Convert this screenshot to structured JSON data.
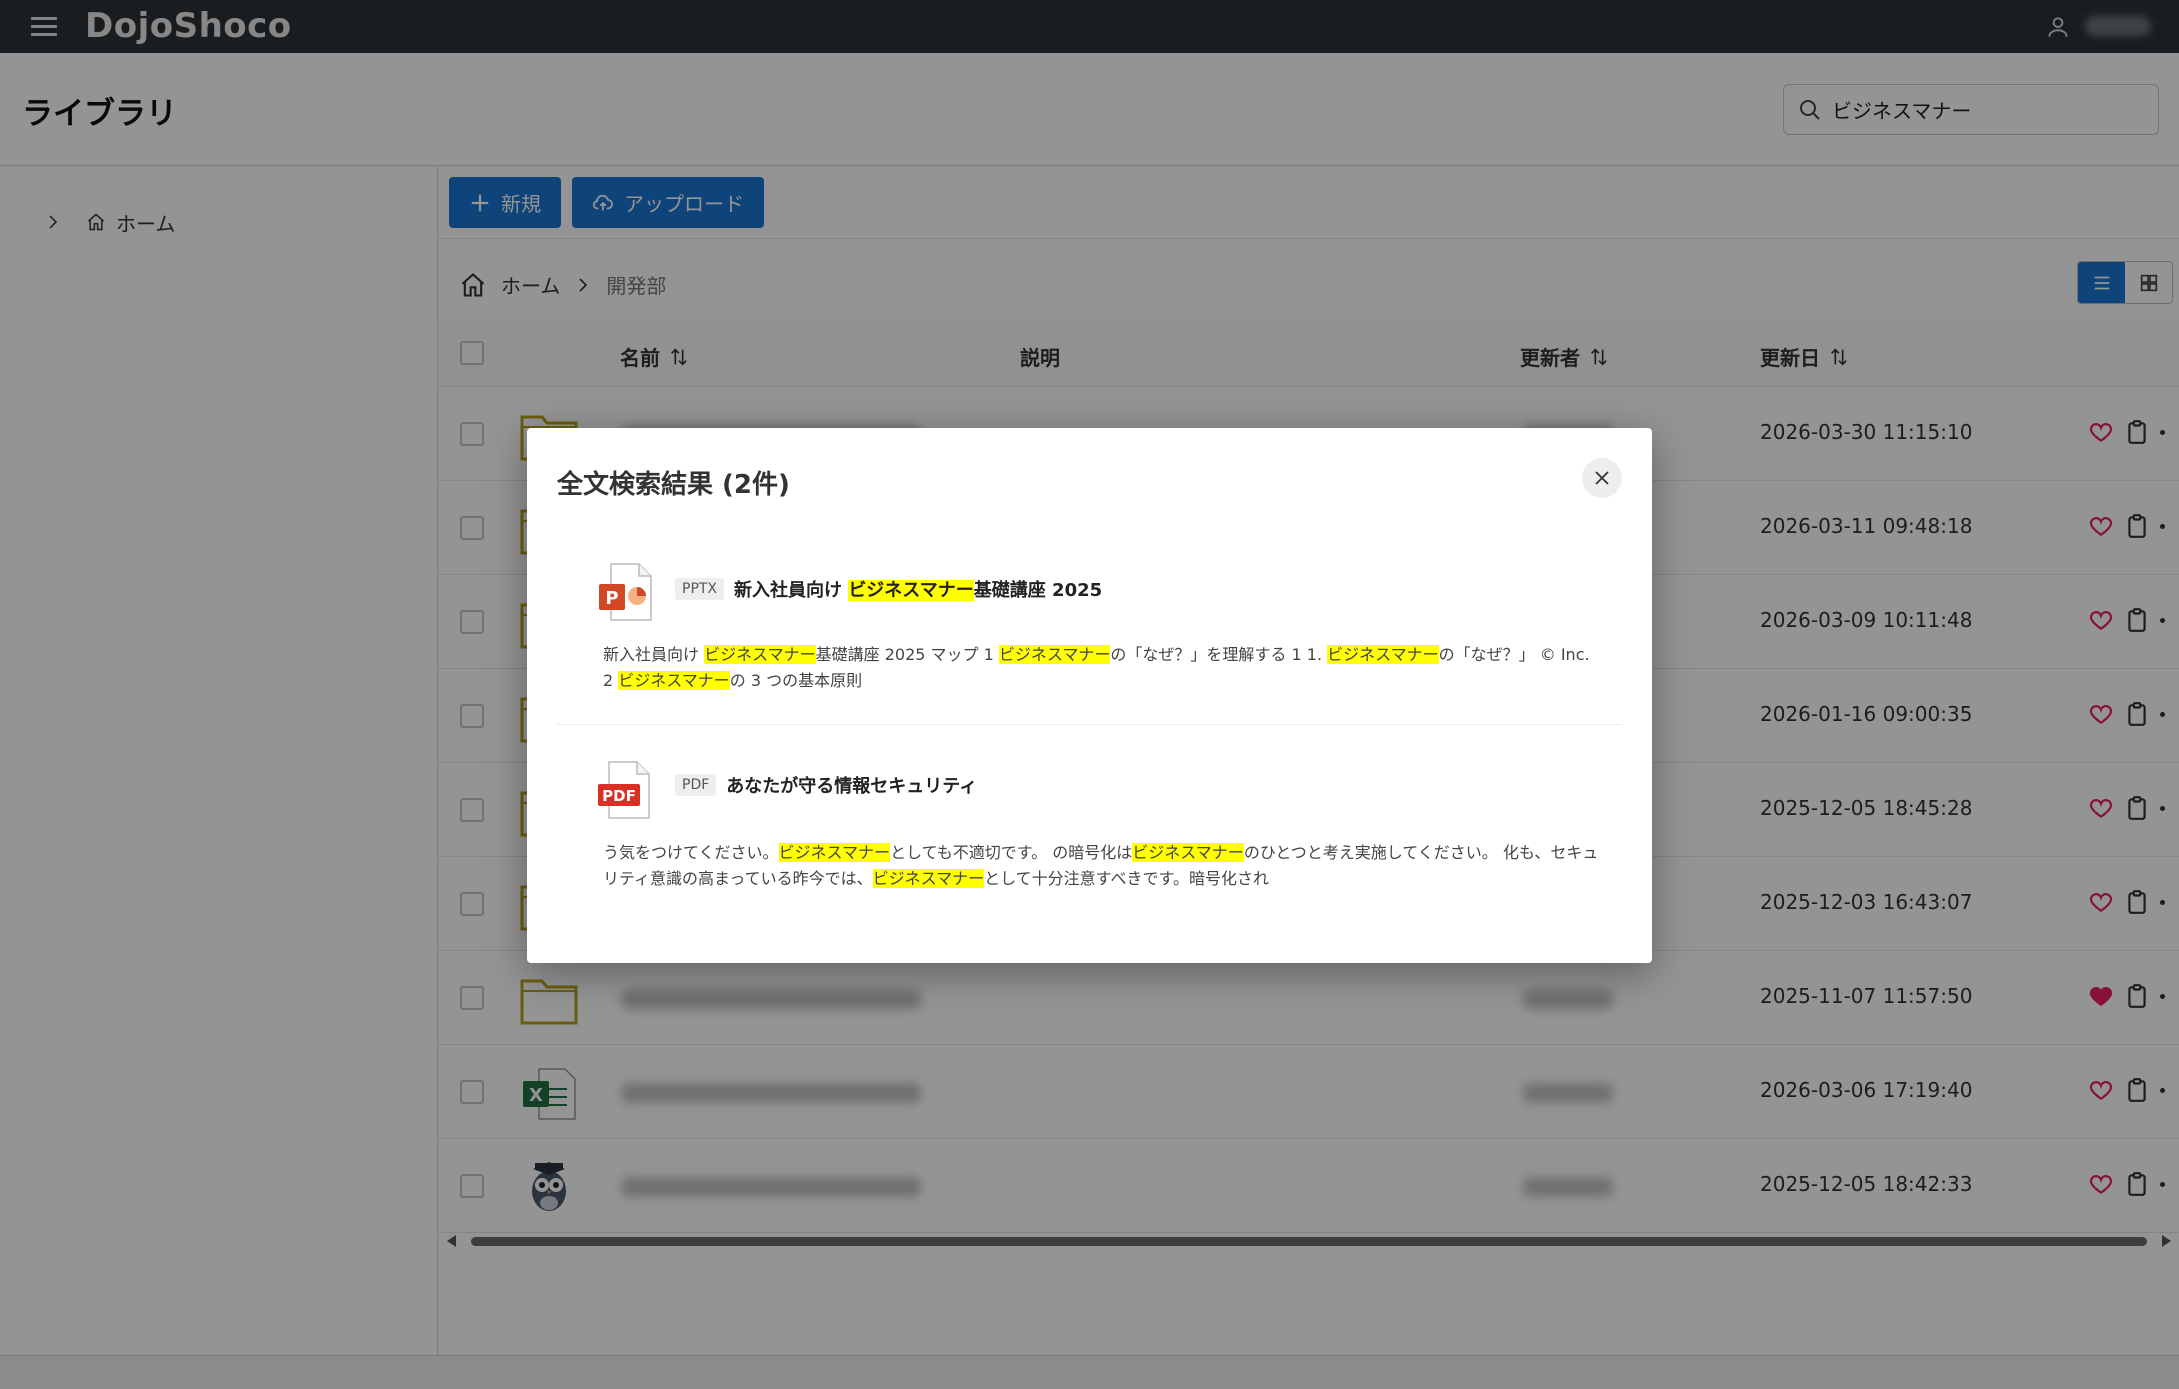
{
  "app": {
    "title": "DojoShoco"
  },
  "page": {
    "title": "ライブラリ"
  },
  "search": {
    "value": "ビジネスマナー"
  },
  "sidebar": {
    "home_label": "ホーム"
  },
  "toolbar": {
    "new_label": "新規",
    "upload_label": "アップロード"
  },
  "breadcrumb": {
    "home": "ホーム",
    "current": "開発部"
  },
  "table": {
    "headers": {
      "name": "名前",
      "description": "説明",
      "updated_by": "更新者",
      "updated_at": "更新日"
    },
    "rows": [
      {
        "type": "folder",
        "date": "2026-03-30 11:15:10",
        "favorite": false
      },
      {
        "type": "folder",
        "date": "2026-03-11 09:48:18",
        "favorite": false
      },
      {
        "type": "folder",
        "date": "2026-03-09 10:11:48",
        "favorite": false
      },
      {
        "type": "folder",
        "date": "2026-01-16 09:00:35",
        "favorite": false
      },
      {
        "type": "folder",
        "date": "2025-12-05 18:45:28",
        "favorite": false
      },
      {
        "type": "folder",
        "date": "2025-12-03 16:43:07",
        "favorite": false
      },
      {
        "type": "folder",
        "date": "2025-11-07 11:57:50",
        "favorite": true
      },
      {
        "type": "excel",
        "date": "2026-03-06 17:19:40",
        "favorite": false
      },
      {
        "type": "owl",
        "date": "2025-12-05 18:42:33",
        "favorite": false
      }
    ]
  },
  "dialog": {
    "title": "全文検索結果 (2件)",
    "results": [
      {
        "badge": "PPTX",
        "icon": "powerpoint-icon",
        "title_before": "新入社員向け ",
        "title_highlight": "ビジネスマナー",
        "title_after": "基礎講座 2025",
        "snippet": [
          {
            "t": "新入社員向け ",
            "h": false
          },
          {
            "t": "ビジネスマナー",
            "h": true
          },
          {
            "t": "基礎講座 2025 マップ 1 ",
            "h": false
          },
          {
            "t": "ビジネスマナー",
            "h": true
          },
          {
            "t": "の「なぜ？」を理解する 1 1. ",
            "h": false
          },
          {
            "t": "ビジネスマナー",
            "h": true
          },
          {
            "t": "の「なぜ？」 © Inc. 2 ",
            "h": false
          },
          {
            "t": "ビジネスマナー",
            "h": true
          },
          {
            "t": "の 3 つの基本原則",
            "h": false
          }
        ]
      },
      {
        "badge": "PDF",
        "icon": "pdf-icon",
        "title_before": "あなたが守る情報セキュリティ",
        "title_highlight": "",
        "title_after": "",
        "snippet": [
          {
            "t": "う気をつけてください。",
            "h": false
          },
          {
            "t": "ビジネスマナー",
            "h": true
          },
          {
            "t": "としても不適切です。 の暗号化は",
            "h": false
          },
          {
            "t": "ビジネスマナー",
            "h": true
          },
          {
            "t": "のひとつと考え実施してください。 化も、セキュリティ意識の高まっている昨今では、",
            "h": false
          },
          {
            "t": "ビジネスマナー",
            "h": true
          },
          {
            "t": "として十分注意すべきです。暗号化され",
            "h": false
          }
        ]
      }
    ]
  },
  "colors": {
    "topbar": "#2d3238",
    "primary": "#1976d2",
    "highlight": "#ffff00",
    "favorite": "#e91e63"
  }
}
